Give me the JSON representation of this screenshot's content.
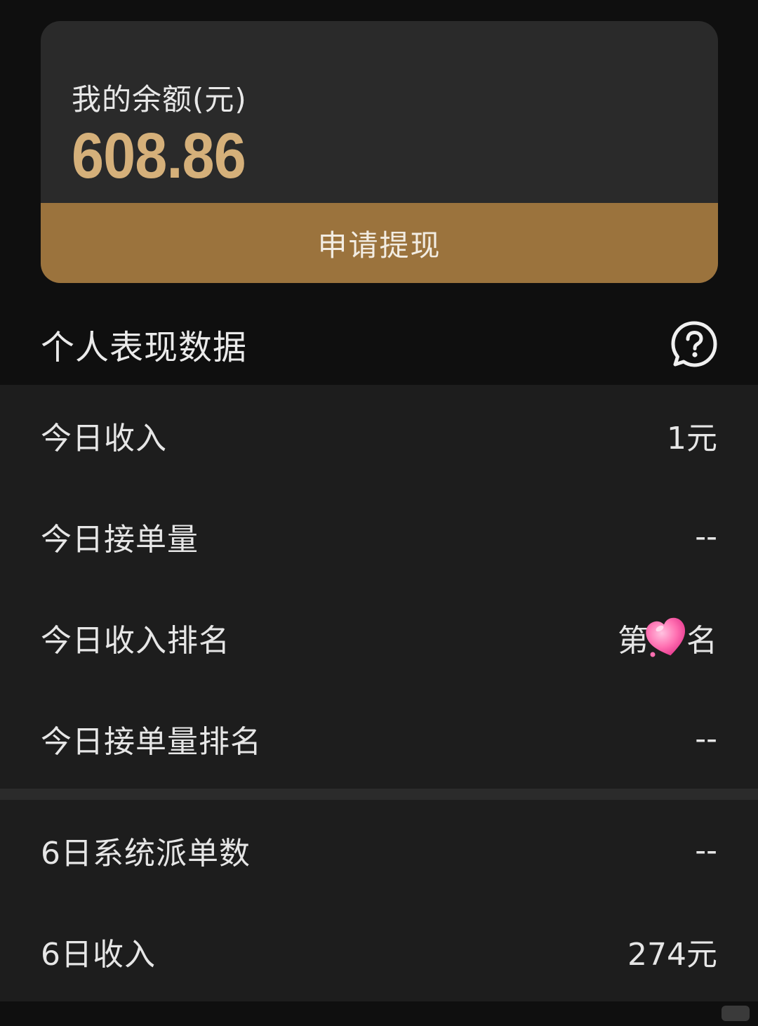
{
  "balance": {
    "label": "我的余额(元)",
    "amount": "608.86",
    "withdraw_label": "申请提现"
  },
  "section": {
    "title": "个人表现数据",
    "help_icon": "question-bubble-icon"
  },
  "stats_today": [
    {
      "label": "今日收入",
      "value": "1元"
    },
    {
      "label": "今日接单量",
      "value": "--"
    },
    {
      "label": "今日收入排名",
      "value_prefix": "第",
      "value_suffix": "名",
      "sticker": "pink-heart-icon"
    },
    {
      "label": "今日接单量排名",
      "value": "--"
    }
  ],
  "stats_6day": [
    {
      "label": "6日系统派单数",
      "value": "--"
    },
    {
      "label": "6日收入",
      "value": "274元"
    }
  ],
  "colors": {
    "accent_gold": "#9b733d",
    "amount_gold": "#d5b07a",
    "card_bg": "#2a2a2a",
    "panel_bg": "#1d1d1d",
    "page_bg": "#0f0f0f"
  }
}
